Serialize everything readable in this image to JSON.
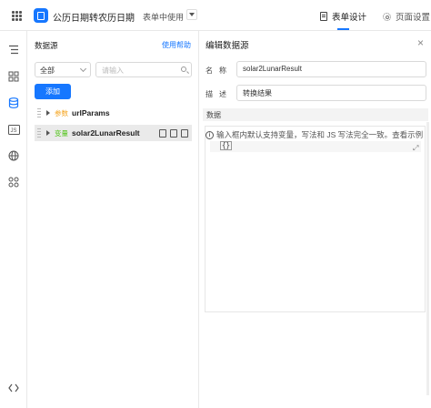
{
  "topbar": {
    "app_title": "公历日期转农历日期",
    "page_name": "表单中使用",
    "tabs": [
      {
        "label": "表单设计",
        "icon": "document-icon",
        "active": true
      },
      {
        "label": "页面设置",
        "icon": "gear-icon",
        "active": false
      }
    ]
  },
  "sidebar": {
    "icons": [
      "outline-icon",
      "components-icon",
      "datasource-icon",
      "js-icon",
      "globe-icon",
      "plugins-icon",
      "code-icon"
    ]
  },
  "datasource_panel": {
    "title": "数据源",
    "help_link": "使用帮助",
    "filter_value": "全部",
    "search_placeholder": "请输入",
    "add_label": "添加",
    "items": [
      {
        "type_tag": "参数",
        "type_color": "#f5a623",
        "name": "urlParams"
      },
      {
        "type_tag": "变量",
        "type_color": "#52c41a",
        "name": "solar2LunarResult"
      }
    ]
  },
  "editor": {
    "title": "编辑数据源",
    "close_symbol": "×",
    "name_label": "名称",
    "name_value": "solar2LunarResult",
    "desc_label": "描述",
    "desc_value": "转换结果",
    "data_section": "数据",
    "hint_text": "输入框内默认支持变量，写法和 JS 写法完全一致。查看示例",
    "code_value": "{}"
  },
  "colors": {
    "accent": "#1677ff"
  }
}
